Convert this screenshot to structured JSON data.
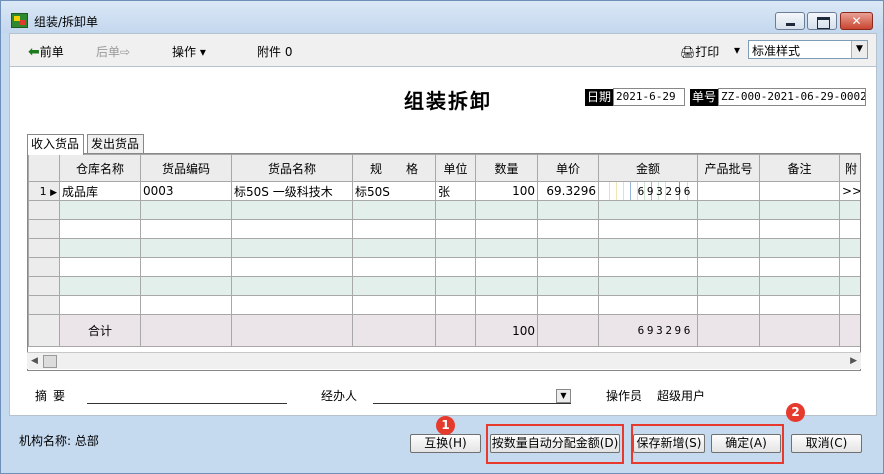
{
  "window": {
    "title": "组装/拆卸单"
  },
  "toolbar": {
    "prev_label": "前单",
    "next_label": "后单",
    "operations_label": "操作 ▾",
    "attachment_label": "附件 0",
    "print_label": "打印",
    "print_caret": "▾",
    "style_value": "标准样式"
  },
  "doc": {
    "title": "组装拆卸",
    "date_label": "日期",
    "date_value": "2021-6-29",
    "no_label": "单号",
    "no_value": "ZZ-000-2021-06-29-0002"
  },
  "tabs": [
    {
      "label": "收入货品",
      "active": true
    },
    {
      "label": "发出货品",
      "active": false
    }
  ],
  "grid": {
    "columns": [
      "仓库名称",
      "货品编码",
      "货品名称",
      "规　　格",
      "单位",
      "数量",
      "单价",
      "金额",
      "产品批号",
      "备注",
      "附"
    ],
    "rows": [
      {
        "row_no": "1",
        "marker": "▶",
        "warehouse": "成品库",
        "code": "0003",
        "name": "标50S 一级科技木",
        "spec": "标50S",
        "unit": "张",
        "qty": "100",
        "price": "69.3296",
        "amount": "693296",
        "batch": "",
        "note": "",
        "attach": ">>"
      }
    ],
    "summary": {
      "label": "合计",
      "qty": "100",
      "amount": "693296"
    }
  },
  "footer": {
    "summary_label": "摘要",
    "handler_label": "经办人",
    "operator_label": "操作员",
    "operator_value": "超级用户"
  },
  "bottom": {
    "org_label": "机构名称: 总部",
    "swap_button": "互换(H)",
    "auto_alloc_button": "按数量自动分配金额(D)",
    "save_new_button": "保存新增(S)",
    "ok_button": "确定(A)",
    "cancel_button": "取消(C)",
    "badge_1": "1",
    "badge_2": "2"
  },
  "colors": {
    "highlight": "#e83a2c",
    "window_bg": "#c5d9ef",
    "grid_alt_row": "#e3efea"
  }
}
